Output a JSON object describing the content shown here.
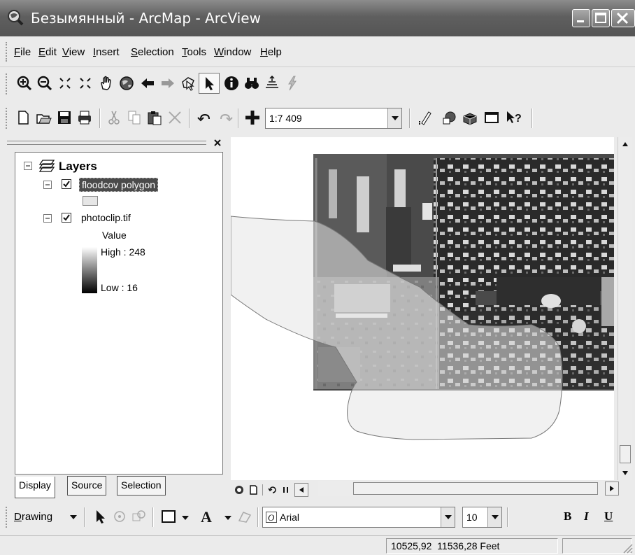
{
  "window": {
    "title": "Безымянный - ArcMap - ArcView",
    "controls": [
      "minimize",
      "maximize",
      "close"
    ]
  },
  "menu": [
    {
      "label": "File",
      "u": "F"
    },
    {
      "label": "Edit",
      "u": "E"
    },
    {
      "label": "View",
      "u": "V"
    },
    {
      "label": "Insert",
      "u": "I"
    },
    {
      "label": "Selection",
      "u": "S"
    },
    {
      "label": "Tools",
      "u": "T"
    },
    {
      "label": "Window",
      "u": "W"
    },
    {
      "label": "Help",
      "u": "H"
    }
  ],
  "tools_toolbar": {
    "buttons": [
      "zoom-in-icon",
      "zoom-out-icon",
      "fixed-zoom-in-icon",
      "fixed-zoom-out-icon",
      "pan-hand-icon",
      "full-extent-globe-icon",
      "back-arrow-icon",
      "forward-arrow-icon",
      "select-features-icon",
      "select-elements-arrow-icon",
      "identify-icon",
      "find-binoculars-icon",
      "go-to-xy-icon",
      "hyperlink-lightning-icon"
    ]
  },
  "standard_toolbar": {
    "buttons": [
      "new-document-icon",
      "open-folder-icon",
      "save-icon",
      "print-icon",
      "cut-icon",
      "copy-icon",
      "paste-icon",
      "delete-icon",
      "undo-icon",
      "redo-icon",
      "add-data-icon"
    ],
    "scale": "1:7 409",
    "right_buttons": [
      "editor-toolbar-icon",
      "arccatalog-icon",
      "arctoolbox-icon",
      "command-line-icon",
      "whats-this-icon"
    ]
  },
  "toc": {
    "root_label": "Layers",
    "layers": [
      {
        "name": "floodcov polygon",
        "checked": true,
        "selected": true
      },
      {
        "name": "photoclip.tif",
        "checked": true,
        "selected": false
      }
    ],
    "legend": {
      "title": "Value",
      "high": "High : 248",
      "low": "Low : 16"
    },
    "tabs": [
      "Display",
      "Source",
      "Selection"
    ],
    "active_tab": "Display"
  },
  "drawing_toolbar": {
    "drawing_label": "Drawing",
    "drawing_u": "D",
    "font": "Arial",
    "font_size": "10",
    "bold": "B",
    "italic": "I",
    "underline": "U"
  },
  "status": {
    "coordinates": "10525,92  11536,28 Feet"
  },
  "colors": {
    "title_bar": "#6f6f6f",
    "selection_highlight": "#4a4a4a",
    "polygon_fill": "#e6e6e6"
  }
}
